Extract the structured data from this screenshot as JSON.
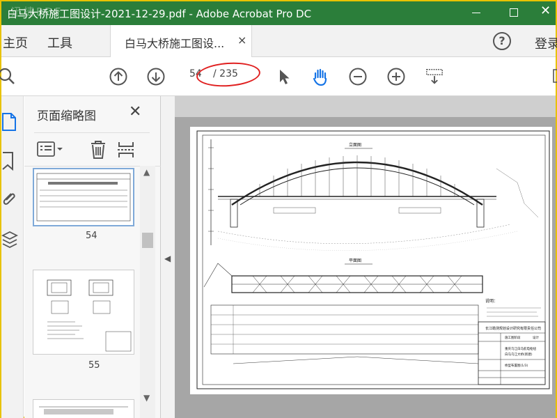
{
  "window": {
    "title": "白马大桥施工图设计-2021-12-29.pdf - Adobe Acrobat Pro DC",
    "watermark": "迅捷PDF"
  },
  "tabs": {
    "home": "主页",
    "tools": "工具",
    "document_tab": "白马大桥施工图设...",
    "close_glyph": "×",
    "help_glyph": "?",
    "login": "登录"
  },
  "toolbar": {
    "current_page": "54",
    "total_pages": "/ 235",
    "annotation_color": "#e02020"
  },
  "thumbnail_pane": {
    "title": "页面缩略图",
    "close_glyph": "✕",
    "pages": [
      {
        "number": "54",
        "selected": true
      },
      {
        "number": "55",
        "selected": false
      }
    ]
  },
  "colors": {
    "titlebar": "#2b7e3a",
    "window_border": "#e8c200",
    "accent_icon": "#1473e6"
  },
  "drawing": {
    "elevation_label": "立面图",
    "plan_label": "平面图",
    "notes_label": "说明：",
    "company": "长江勘测规划设计研究有限责任公司",
    "project_line1": "重庆乌江白马航电枢纽",
    "project_line2": "白马乌江大桥(新建)",
    "sheet_title": "桥型布置图(1/3)",
    "stage": "施工图阶段",
    "discipline": "设计"
  }
}
